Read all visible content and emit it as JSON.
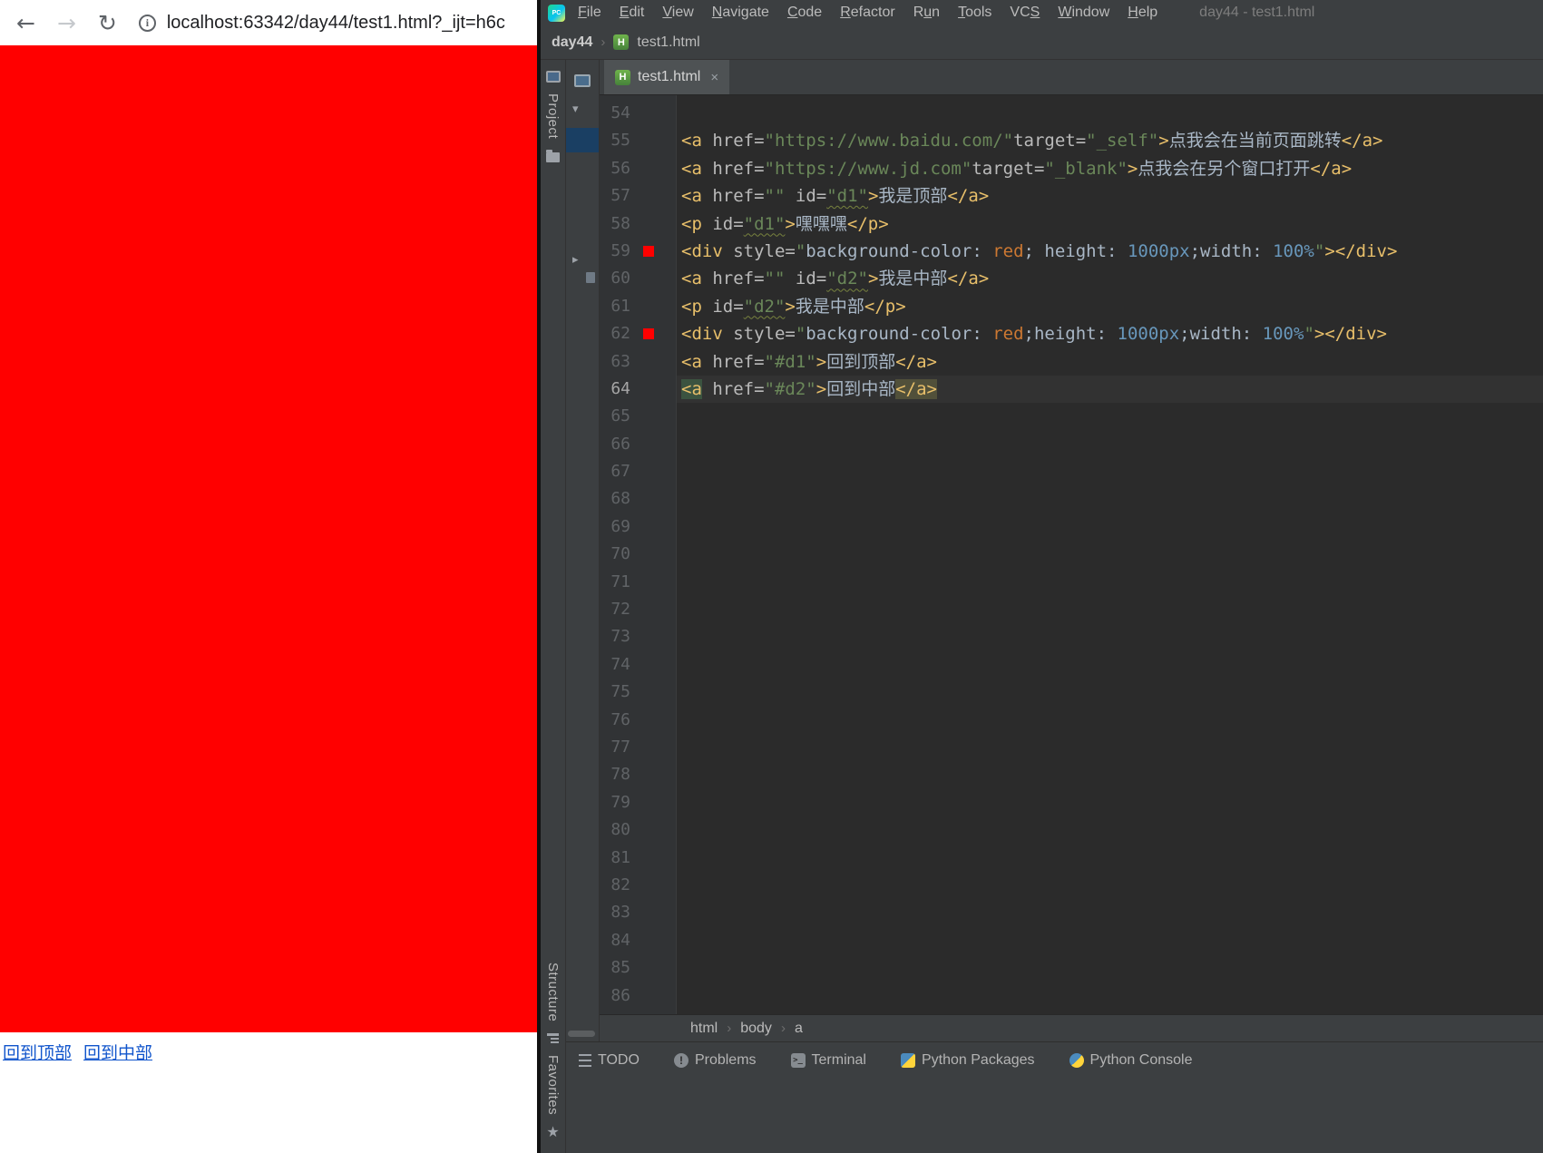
{
  "browser": {
    "toolbar": {
      "url": "localhost:63342/day44/test1.html?_ijt=h6c"
    },
    "page": {
      "background": "#ff0000",
      "links": [
        {
          "label": "回到顶部"
        },
        {
          "label": "回到中部"
        }
      ]
    }
  },
  "ide": {
    "menu_bar": {
      "items": [
        {
          "label": "File",
          "m": 0
        },
        {
          "label": "Edit",
          "m": 0
        },
        {
          "label": "View",
          "m": 0
        },
        {
          "label": "Navigate",
          "m": 0
        },
        {
          "label": "Code",
          "m": 0
        },
        {
          "label": "Refactor",
          "m": 0
        },
        {
          "label": "Run",
          "m": 1
        },
        {
          "label": "Tools",
          "m": 0
        },
        {
          "label": "VCS",
          "m": 2
        },
        {
          "label": "Window",
          "m": 0
        },
        {
          "label": "Help",
          "m": 0
        }
      ],
      "window_title": "day44 - test1.html"
    },
    "breadcrumbs": {
      "project": "day44",
      "separator": "›",
      "file": "test1.html",
      "file_icon": "H"
    },
    "tabs": [
      {
        "label": "test1.html",
        "close": "×",
        "active": true
      }
    ],
    "tool_stripes": {
      "project": "Project",
      "structure": "Structure",
      "favorites": "Favorites"
    },
    "editor": {
      "active_line": 64,
      "lines": [
        {
          "n": 54,
          "tokens": []
        },
        {
          "n": 55,
          "tokens": [
            [
              "tag",
              "<a "
            ],
            [
              "attr",
              "href="
            ],
            [
              "str",
              "\"https://www.baidu.com/\""
            ],
            [
              "attr",
              "target="
            ],
            [
              "str",
              "\"_self\""
            ],
            [
              "tag",
              ">"
            ],
            [
              "txt",
              "点我会在当前页面跳转"
            ],
            [
              "tag",
              "</a>"
            ]
          ]
        },
        {
          "n": 56,
          "tokens": [
            [
              "tag",
              "<a "
            ],
            [
              "attr",
              "href="
            ],
            [
              "str",
              "\"https://www.jd.com\""
            ],
            [
              "attr",
              "target="
            ],
            [
              "str",
              "\"_blank\""
            ],
            [
              "tag",
              ">"
            ],
            [
              "txt",
              "点我会在另个窗口打开"
            ],
            [
              "tag",
              "</a>"
            ]
          ]
        },
        {
          "n": 57,
          "tokens": [
            [
              "tag",
              "<a "
            ],
            [
              "attr",
              "href="
            ],
            [
              "str",
              "\"\""
            ],
            [
              "plain",
              " "
            ],
            [
              "attr",
              "id="
            ],
            [
              "strw",
              "\"d1\""
            ],
            [
              "tag",
              ">"
            ],
            [
              "txt",
              "我是顶部"
            ],
            [
              "tag",
              "</a>"
            ]
          ]
        },
        {
          "n": 58,
          "tokens": [
            [
              "tag",
              "<p "
            ],
            [
              "attr",
              "id="
            ],
            [
              "strw",
              "\"d1\""
            ],
            [
              "tag",
              ">"
            ],
            [
              "txt",
              "嘿嘿嘿"
            ],
            [
              "tag",
              "</p>"
            ]
          ]
        },
        {
          "n": 59,
          "swatch": "#ff0000",
          "tokens": [
            [
              "tag",
              "<div "
            ],
            [
              "attr",
              "style="
            ],
            [
              "str",
              "\""
            ],
            [
              "css",
              "background-color: "
            ],
            [
              "kw",
              "red"
            ],
            [
              "plain",
              "; "
            ],
            [
              "css",
              "height: "
            ],
            [
              "num",
              "1000px"
            ],
            [
              "plain",
              ";"
            ],
            [
              "css",
              "width: "
            ],
            [
              "num",
              "100%"
            ],
            [
              "str",
              "\""
            ],
            [
              "tag",
              "></div>"
            ]
          ]
        },
        {
          "n": 60,
          "tokens": [
            [
              "tag",
              "<a "
            ],
            [
              "attr",
              "href="
            ],
            [
              "str",
              "\"\""
            ],
            [
              "plain",
              " "
            ],
            [
              "attr",
              "id="
            ],
            [
              "strw",
              "\"d2\""
            ],
            [
              "tag",
              ">"
            ],
            [
              "txt",
              "我是中部"
            ],
            [
              "tag",
              "</a>"
            ]
          ]
        },
        {
          "n": 61,
          "tokens": [
            [
              "tag",
              "<p "
            ],
            [
              "attr",
              "id="
            ],
            [
              "strw",
              "\"d2\""
            ],
            [
              "tag",
              ">"
            ],
            [
              "txt",
              "我是中部"
            ],
            [
              "tag",
              "</p>"
            ]
          ]
        },
        {
          "n": 62,
          "swatch": "#ff0000",
          "tokens": [
            [
              "tag",
              "<div "
            ],
            [
              "attr",
              "style="
            ],
            [
              "str",
              "\""
            ],
            [
              "css",
              "background-color: "
            ],
            [
              "kw",
              "red"
            ],
            [
              "plain",
              ";"
            ],
            [
              "css",
              "height: "
            ],
            [
              "num",
              "1000px"
            ],
            [
              "plain",
              ";"
            ],
            [
              "css",
              "width: "
            ],
            [
              "num",
              "100%"
            ],
            [
              "str",
              "\""
            ],
            [
              "tag",
              "></div>"
            ]
          ]
        },
        {
          "n": 63,
          "tokens": [
            [
              "tag",
              "<a "
            ],
            [
              "attr",
              "href="
            ],
            [
              "str",
              "\"#d1\""
            ],
            [
              "tag",
              ">"
            ],
            [
              "txt",
              "回到顶部"
            ],
            [
              "tag",
              "</a>"
            ]
          ]
        },
        {
          "n": 64,
          "active": true,
          "tokens": [
            [
              "tagh1",
              "<a"
            ],
            [
              "plain",
              " "
            ],
            [
              "attr",
              "href="
            ],
            [
              "str",
              "\"#d2\""
            ],
            [
              "tag",
              ">"
            ],
            [
              "txt",
              "回到中部"
            ],
            [
              "tagh2",
              "</a>"
            ]
          ]
        },
        {
          "n": 65,
          "tokens": []
        },
        {
          "n": 66,
          "tokens": []
        },
        {
          "n": 67,
          "tokens": []
        },
        {
          "n": 68,
          "tokens": []
        },
        {
          "n": 69,
          "tokens": []
        },
        {
          "n": 70,
          "tokens": []
        },
        {
          "n": 71,
          "tokens": []
        },
        {
          "n": 72,
          "tokens": []
        },
        {
          "n": 73,
          "tokens": []
        },
        {
          "n": 74,
          "tokens": []
        },
        {
          "n": 75,
          "tokens": []
        },
        {
          "n": 76,
          "tokens": []
        },
        {
          "n": 77,
          "tokens": []
        },
        {
          "n": 78,
          "tokens": []
        },
        {
          "n": 79,
          "tokens": []
        },
        {
          "n": 80,
          "tokens": []
        },
        {
          "n": 81,
          "tokens": []
        },
        {
          "n": 82,
          "tokens": []
        },
        {
          "n": 83,
          "tokens": []
        },
        {
          "n": 84,
          "tokens": []
        },
        {
          "n": 85,
          "tokens": []
        },
        {
          "n": 86,
          "tokens": []
        }
      ]
    },
    "nav_bar": {
      "path": [
        "html",
        "body",
        "a"
      ],
      "separator": "›"
    },
    "bottom_bar": {
      "items": [
        {
          "label": "TODO",
          "icon": "todo-icon"
        },
        {
          "label": "Problems",
          "icon": "problems-icon"
        },
        {
          "label": "Terminal",
          "icon": "terminal-icon"
        },
        {
          "label": "Python Packages",
          "icon": "python-packages-icon"
        },
        {
          "label": "Python Console",
          "icon": "python-console-icon"
        }
      ]
    },
    "colors": {
      "editor_bg": "#2b2b2b",
      "panel_bg": "#3c3f41",
      "gutter_bg": "#313335",
      "tag": "#e8bf6a",
      "string": "#6a8759",
      "number": "#6897bb",
      "keyword": "#cc7832",
      "swatch_red": "#ff0000"
    }
  }
}
